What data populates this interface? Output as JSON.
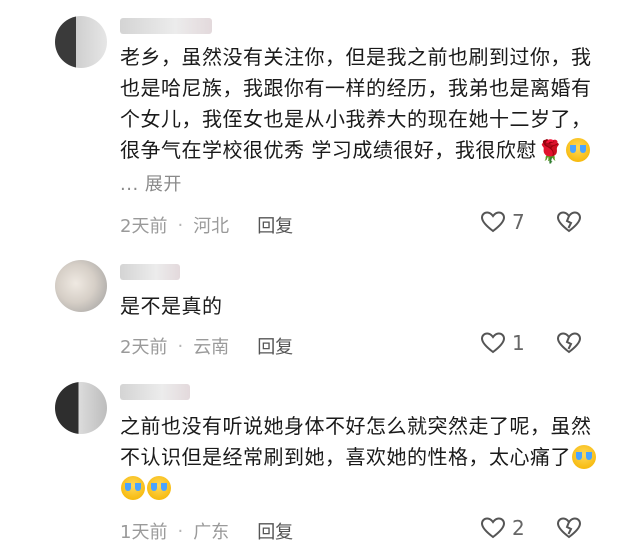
{
  "comments": [
    {
      "text": "老乡，虽然没有关注你，但是我之前也刷到过你，我也是哈尼族，我跟你有一样的经历，我弟也是离婚有个女儿，我侄女也是从小我养大的现在她十二岁了，很争气在学校很优秀 学习成绩很好，我很欣慰",
      "more": "... 展开",
      "time": "2天前",
      "location": "河北",
      "reply": "回复",
      "likes": "7"
    },
    {
      "text": "是不是真的",
      "time": "2天前",
      "location": "云南",
      "reply": "回复",
      "likes": "1"
    },
    {
      "text": "之前也没有听说她身体不好怎么就突然走了呢，虽然不认识但是经常刷到她，喜欢她的性格，太心痛了",
      "time": "1天前",
      "location": "广东",
      "reply": "回复",
      "likes": "2"
    }
  ],
  "icons": {
    "like": "heart-outline-icon",
    "dislike": "broken-heart-icon",
    "rose": "rose-emoji",
    "cry": "crying-face-emoji"
  }
}
